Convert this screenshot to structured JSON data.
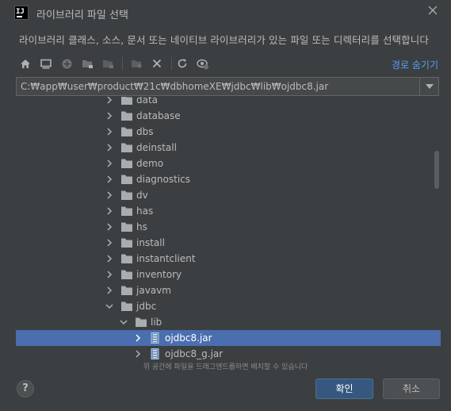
{
  "window": {
    "title": "라이브러리 파일 선택",
    "app_icon_text": "IJ"
  },
  "description": "라이브러리 클래스, 소스, 문서 또는 네이티브 라이브러리가 있는 파일 또는 디렉터리를 선택합니다",
  "toolbar": {
    "hide_path_label": "경로 숨기기",
    "icons": [
      "home-icon",
      "desktop-icon",
      "project-icon",
      "module-icon",
      "folder-icon",
      "new-folder-icon",
      "delete-icon",
      "refresh-icon",
      "show-hidden-icon"
    ]
  },
  "path": {
    "value": "C:₩app₩user₩product₩21c₩dbhomeXE₩jdbc₩lib₩ojdbc8.jar"
  },
  "tree": {
    "items": [
      {
        "label": "data",
        "type": "folder",
        "expanded": false,
        "depth": 1
      },
      {
        "label": "database",
        "type": "folder",
        "expanded": false,
        "depth": 1
      },
      {
        "label": "dbs",
        "type": "folder",
        "expanded": false,
        "depth": 1
      },
      {
        "label": "deinstall",
        "type": "folder",
        "expanded": false,
        "depth": 1
      },
      {
        "label": "demo",
        "type": "folder",
        "expanded": false,
        "depth": 1
      },
      {
        "label": "diagnostics",
        "type": "folder",
        "expanded": false,
        "depth": 1
      },
      {
        "label": "dv",
        "type": "folder",
        "expanded": false,
        "depth": 1
      },
      {
        "label": "has",
        "type": "folder",
        "expanded": false,
        "depth": 1
      },
      {
        "label": "hs",
        "type": "folder",
        "expanded": false,
        "depth": 1
      },
      {
        "label": "install",
        "type": "folder",
        "expanded": false,
        "depth": 1
      },
      {
        "label": "instantclient",
        "type": "folder",
        "expanded": false,
        "depth": 1
      },
      {
        "label": "inventory",
        "type": "folder",
        "expanded": false,
        "depth": 1
      },
      {
        "label": "javavm",
        "type": "folder",
        "expanded": false,
        "depth": 1
      },
      {
        "label": "jdbc",
        "type": "folder",
        "expanded": true,
        "depth": 1
      },
      {
        "label": "lib",
        "type": "folder",
        "expanded": true,
        "depth": 2
      },
      {
        "label": "ojdbc8.jar",
        "type": "jar",
        "expanded": false,
        "depth": 3,
        "selected": true
      },
      {
        "label": "ojdbc8_g.jar",
        "type": "jar",
        "expanded": false,
        "depth": 3
      }
    ]
  },
  "drag_hint": "위 공간에 파일을 드래그앤드롭하면 배치할 수 있습니다",
  "buttons": {
    "help": "?",
    "ok": "확인",
    "cancel": "취소"
  },
  "colors": {
    "background": "#3c3f41",
    "selection": "#4b6eaf",
    "link": "#589df6",
    "primary_button": "#365880"
  }
}
